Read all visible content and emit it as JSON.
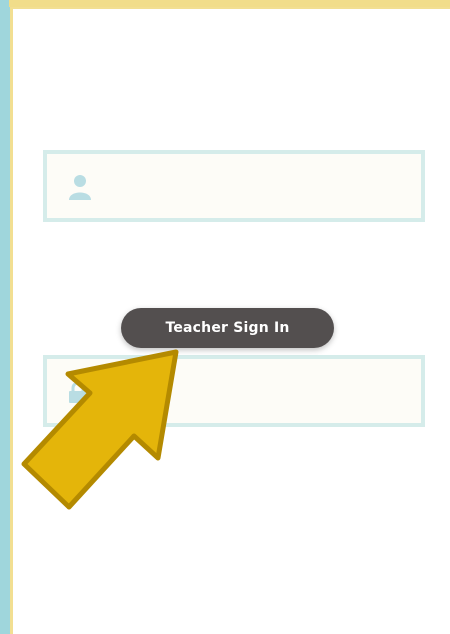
{
  "login": {
    "username": {
      "value": "",
      "placeholder": "",
      "icon": "user-icon"
    },
    "password": {
      "value": "",
      "placeholder": "",
      "icon": "lock-icon"
    }
  },
  "tooltip": {
    "label": "Teacher Sign In"
  },
  "pointer": {
    "icon": "arrow-pointer-icon",
    "color": "#e4b50a",
    "outline": "#b48a00"
  },
  "colors": {
    "frame": "#9fd6dc",
    "accent": "#f1dd8a",
    "field_border": "#d5ecea",
    "field_bg": "#fdfcf7",
    "tooltip_bg": "#534f4f"
  }
}
